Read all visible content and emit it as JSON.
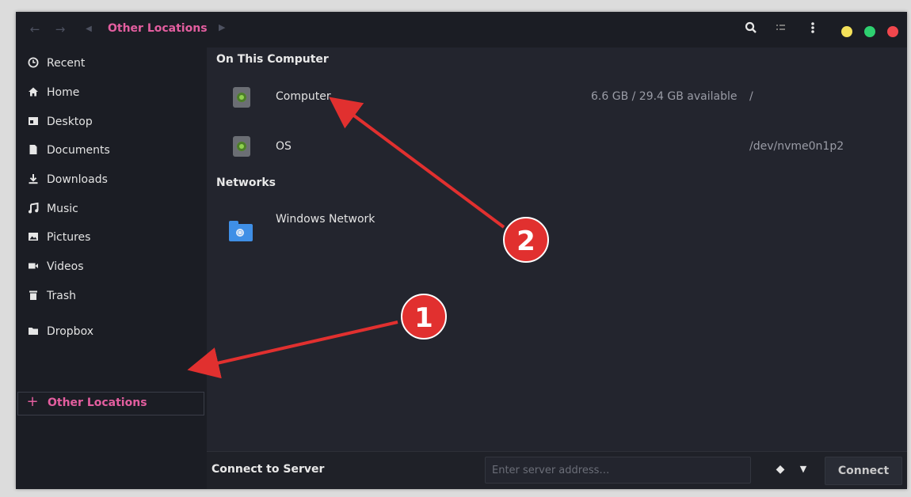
{
  "titlebar": {
    "breadcrumb": "Other Locations",
    "icons": [
      "back-icon",
      "forward-icon",
      "path-left-icon",
      "path-right-icon",
      "search-icon",
      "view-list-icon",
      "menu-icon"
    ],
    "window_dots": [
      "#f4e15a",
      "#2ed070",
      "#f1474d"
    ]
  },
  "sidebar": {
    "items": [
      {
        "label": "Recent",
        "icon": "clock-icon"
      },
      {
        "label": "Home",
        "icon": "home-icon"
      },
      {
        "label": "Desktop",
        "icon": "desktop-icon"
      },
      {
        "label": "Documents",
        "icon": "document-icon"
      },
      {
        "label": "Downloads",
        "icon": "download-icon"
      },
      {
        "label": "Music",
        "icon": "music-icon"
      },
      {
        "label": "Pictures",
        "icon": "picture-icon"
      },
      {
        "label": "Videos",
        "icon": "video-icon"
      },
      {
        "label": "Trash",
        "icon": "trash-icon"
      },
      {
        "label": "Dropbox",
        "icon": "folder-icon"
      }
    ],
    "other_locations": {
      "label": "Other Locations",
      "icon": "plus-icon"
    }
  },
  "main": {
    "sections": [
      {
        "title": "On This Computer",
        "rows": [
          {
            "name": "Computer",
            "usage": "6.6 GB / 29.4 GB available",
            "path": "/"
          },
          {
            "name": "OS",
            "usage": "",
            "path": "/dev/nvme0n1p2"
          }
        ]
      },
      {
        "title": "Networks",
        "rows": [
          {
            "name": "Windows Network",
            "usage": "",
            "path": ""
          }
        ]
      }
    ]
  },
  "footer": {
    "label": "Connect to Server",
    "placeholder": "Enter server address…",
    "connect_label": "Connect"
  },
  "annotations": {
    "badge_1": "1",
    "badge_2": "2",
    "color": "#e1302f"
  }
}
